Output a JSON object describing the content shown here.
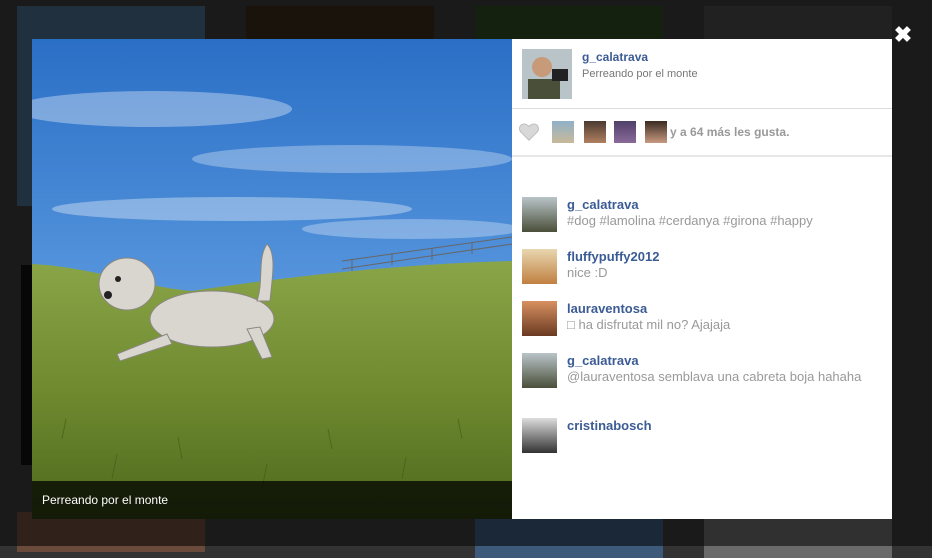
{
  "close": {
    "label": "✖"
  },
  "photo": {
    "caption": "Perreando por el monte"
  },
  "owner": {
    "username": "g_calatrava",
    "caption": "Perreando por el monte"
  },
  "likes": {
    "text": "y a 64 más les gusta."
  },
  "comments": [
    {
      "user": "g_calatrava",
      "text": "#dog #lamolina #cerdanya #girona #happy"
    },
    {
      "user": "fluffypuffy2012",
      "text": "nice :D"
    },
    {
      "user": "lauraventosa",
      "text": "□ ha disfrutat mil no? Ajajaja"
    },
    {
      "user": "g_calatrava",
      "text": "@lauraventosa semblava una cabreta boja hahaha"
    },
    {
      "user": "cristinabosch",
      "text": ""
    }
  ],
  "colors": {
    "username": "#3b5b94",
    "muted": "#999999",
    "overlay": "#000000"
  }
}
